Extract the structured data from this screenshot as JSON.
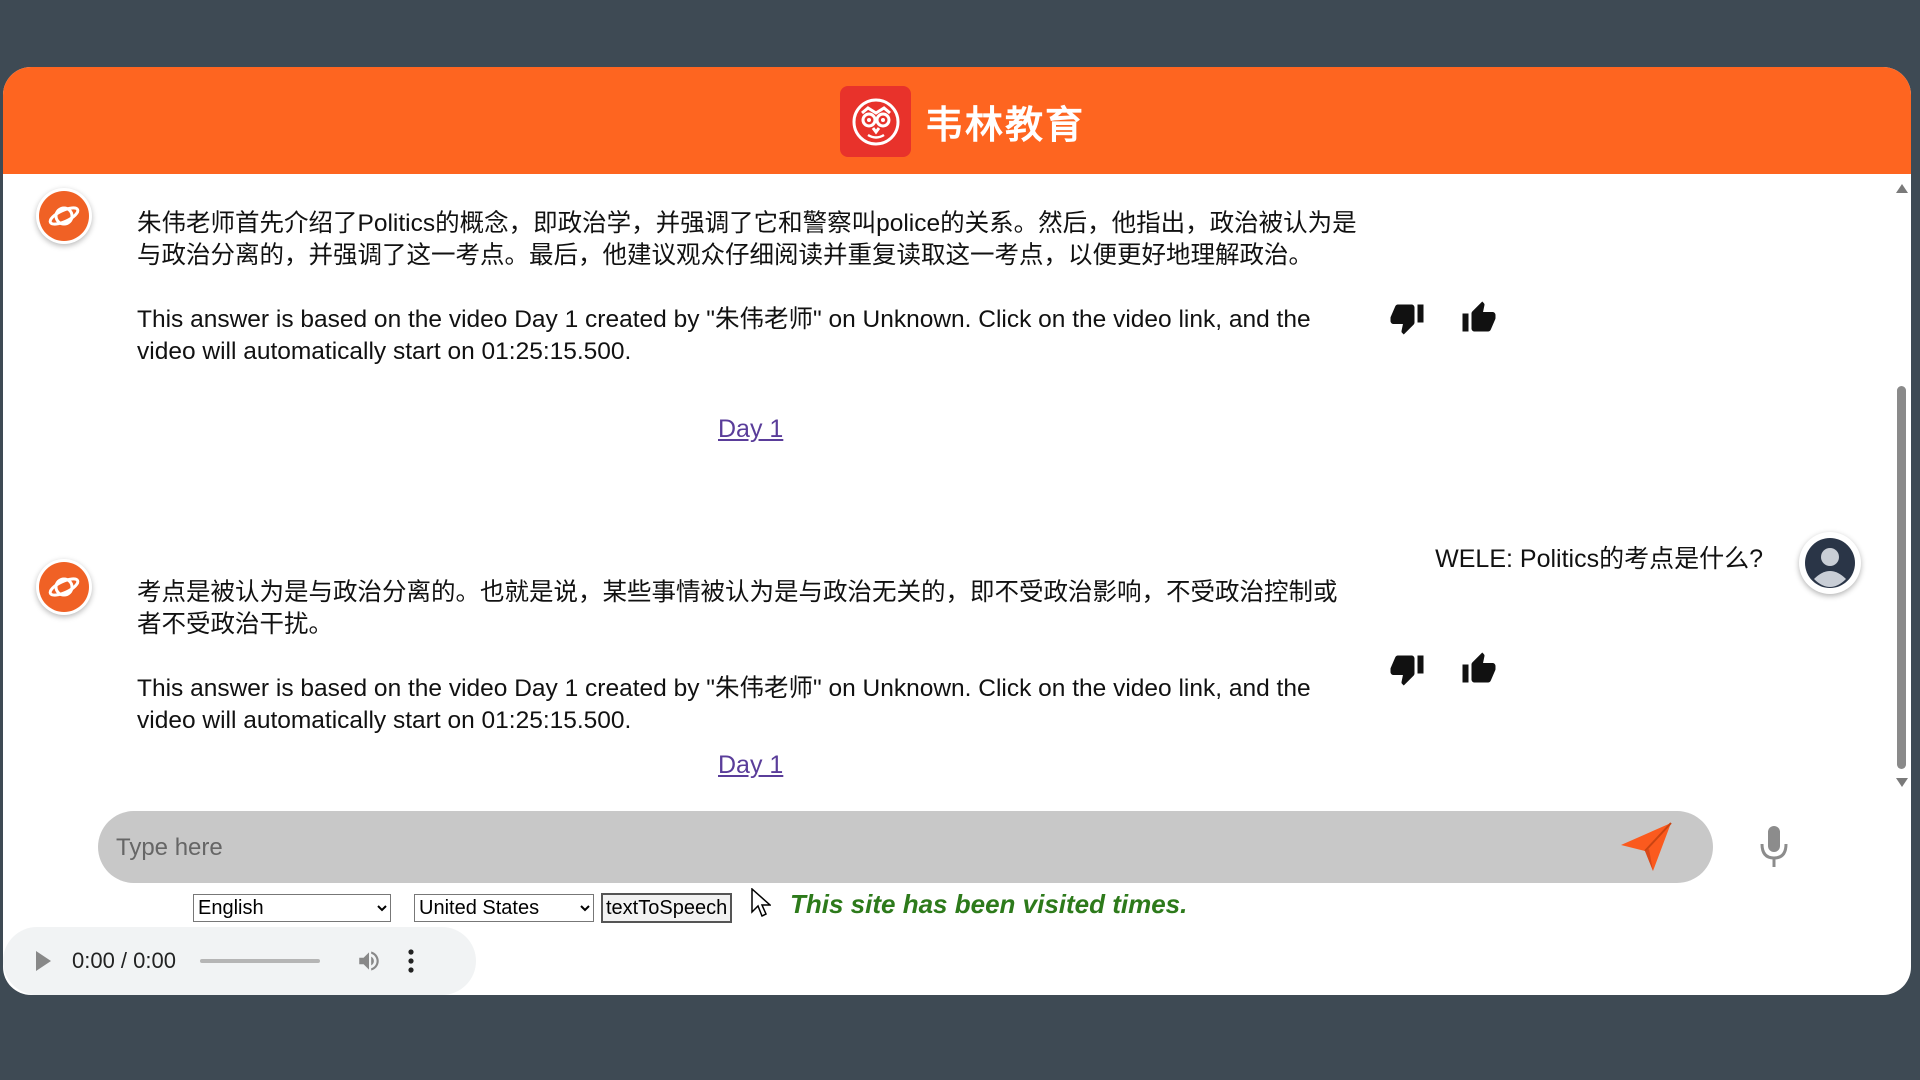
{
  "app": {
    "brand_name": "韦林教育"
  },
  "messages": [
    {
      "role": "bot",
      "text_cn": "朱伟老师首先介绍了Politics的概念，即政治学，并强调了它和警察叫police的关系。然后，他指出，政治被认为是与政治分离的，并强调了这一考点。最后，他建议观众仔细阅读并重复读取这一考点，以便更好地理解政治。",
      "text_en": "This answer is based on the video Day 1 created by \"朱伟老师\" on Unknown. Click on the video link, and the video will automatically start on 01:25:15.500.",
      "link": "Day 1"
    },
    {
      "role": "user",
      "text": "WELE: Politics的考点是什么?"
    },
    {
      "role": "bot",
      "text_cn": "考点是被认为是与政治分离的。也就是说，某些事情被认为是与政治无关的，即不受政治影响，不受政治控制或者不受政治干扰。",
      "text_en": "This answer is based on the video Day 1 created by \"朱伟老师\" on Unknown. Click on the video link, and the video will automatically start on 01:25:15.500.",
      "link": "Day 1"
    }
  ],
  "input": {
    "placeholder": "Type here"
  },
  "controls": {
    "language": "English",
    "country": "United States",
    "tts_label": "textToSpeech",
    "visited_text": "This site has been visited times."
  },
  "audio": {
    "time": "0:00 / 0:00"
  },
  "icons": {
    "logo": "owl-logo-icon",
    "bot_avatar": "planet-icon",
    "user_avatar": "user-icon",
    "dislike": "thumbs-down-icon",
    "like": "thumbs-up-icon",
    "send": "paper-plane-icon",
    "mic": "microphone-icon"
  },
  "colors": {
    "header": "#fe6520",
    "logo_bg": "#e8322b",
    "input_bg": "#c8c8c8",
    "visited_text": "#2d7a1b",
    "link": "#5a3d9a"
  }
}
